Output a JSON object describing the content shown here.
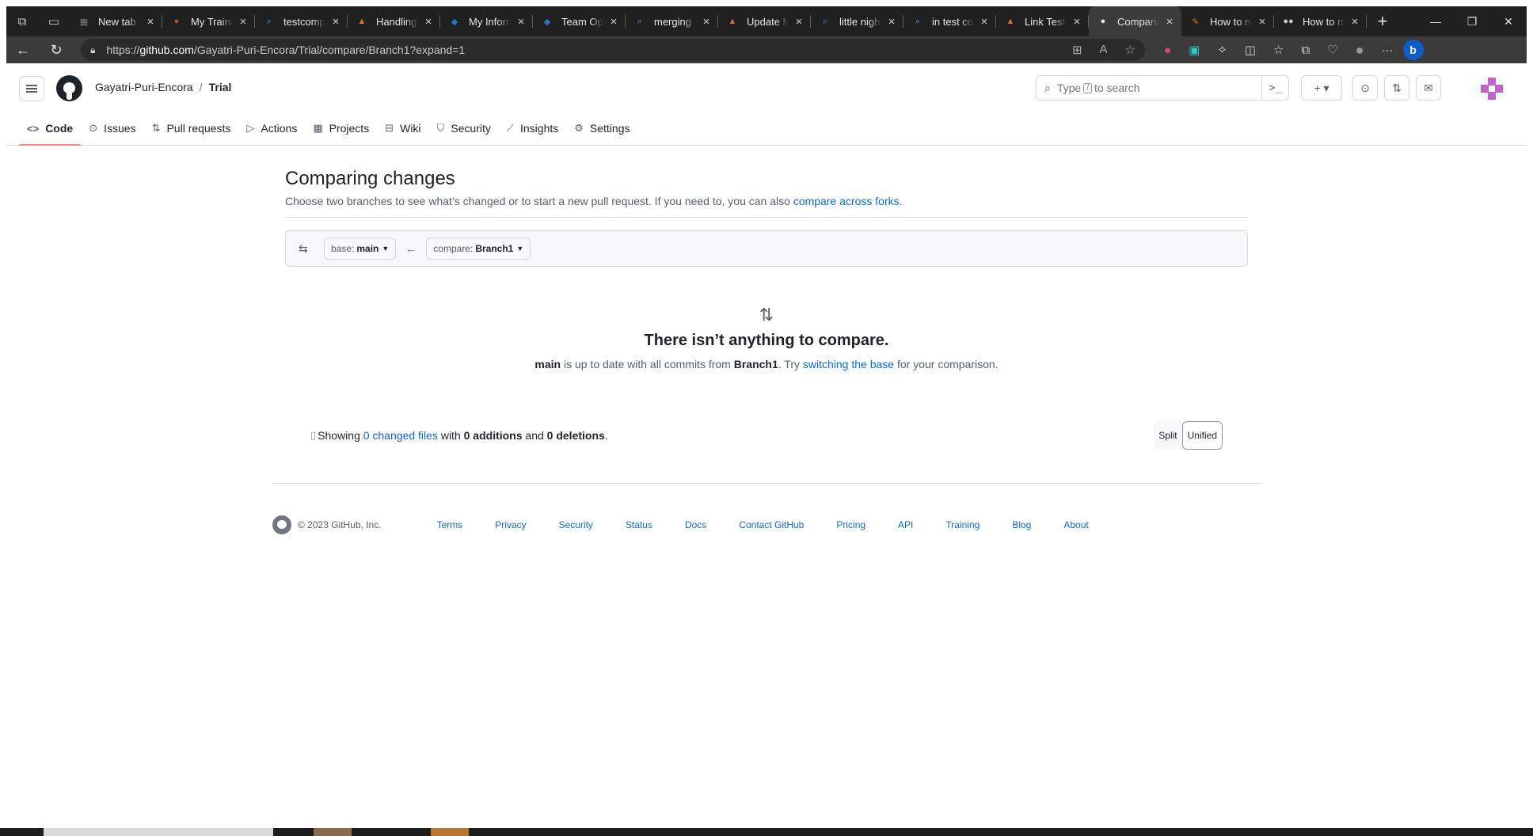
{
  "browser": {
    "tabs": [
      {
        "title": "New tab",
        "fav": "▦",
        "color": "#7a7a7a"
      },
      {
        "title": "My Training",
        "fav": "●",
        "color": "#b2532a"
      },
      {
        "title": "testcomp",
        "fav": "⌕",
        "color": "#4aa0e6"
      },
      {
        "title": "Handling",
        "fav": "▲",
        "color": "#d9712b"
      },
      {
        "title": "My Inform",
        "fav": "◆",
        "color": "#1f78d1"
      },
      {
        "title": "Team Opt",
        "fav": "◆",
        "color": "#1f78d1"
      },
      {
        "title": "merging",
        "fav": "⌕",
        "color": "#4aa0e6"
      },
      {
        "title": "Update N",
        "fav": "▲",
        "color": "#d9712b"
      },
      {
        "title": "little nigh",
        "fav": "⌕",
        "color": "#4aa0e6"
      },
      {
        "title": "in test co",
        "fav": "⌕",
        "color": "#4aa0e6"
      },
      {
        "title": "Link TestC",
        "fav": "▲",
        "color": "#d9712b"
      },
      {
        "title": "Comparin",
        "fav": "●",
        "color": "#e6e6e6",
        "active": true
      },
      {
        "title": "How to m",
        "fav": "✎",
        "color": "#d9712b"
      },
      {
        "title": "How to m",
        "fav": "●●",
        "color": "#cccccc"
      }
    ],
    "url_prefix": "https://",
    "url_host": "github.com",
    "url_path": "/Gayatri-Puri-Encora/Trial/compare/Branch1?expand=1"
  },
  "header": {
    "owner": "Gayatri-Puri-Encora",
    "separator": "/",
    "repo": "Trial",
    "search_before": "Type",
    "search_key": "/",
    "search_after": "to search",
    "plus_label": "+ ▾"
  },
  "repo_nav": [
    {
      "label": "Code",
      "icon": "<>",
      "selected": true
    },
    {
      "label": "Issues",
      "icon": "⊙"
    },
    {
      "label": "Pull requests",
      "icon": "⇅"
    },
    {
      "label": "Actions",
      "icon": "▷"
    },
    {
      "label": "Projects",
      "icon": "▦"
    },
    {
      "label": "Wiki",
      "icon": "⊟"
    },
    {
      "label": "Security",
      "icon": "⛉"
    },
    {
      "label": "Insights",
      "icon": "⟋"
    },
    {
      "label": "Settings",
      "icon": "⚙"
    }
  ],
  "compare": {
    "title": "Comparing changes",
    "description": "Choose two branches to see what’s changed or to start a new pull request. If you need to, you can also",
    "forks_link": "compare across forks",
    "forks_end": ".",
    "base_label": "base:",
    "base_value": "main",
    "compare_label": "compare:",
    "compare_value": "Branch1",
    "empty_title": "There isn’t anything to compare.",
    "empty_base": "main",
    "empty_mid": "is up to date with all commits from",
    "empty_branch": "Branch1",
    "empty_try": ". Try",
    "empty_link": "switching the base",
    "empty_end": "for your comparison.",
    "toc_showing": "Showing",
    "toc_files_link": "0 changed files",
    "toc_with": "with",
    "toc_additions": "0 additions",
    "toc_and": "and",
    "toc_deletions": "0 deletions",
    "toc_period": ".",
    "split_label": "Split",
    "unified_label": "Unified"
  },
  "footer": {
    "copyright": "© 2023 GitHub, Inc.",
    "links": [
      "Terms",
      "Privacy",
      "Security",
      "Status",
      "Docs",
      "Contact GitHub",
      "Pricing",
      "API",
      "Training",
      "Blog",
      "About"
    ]
  },
  "colors": {
    "link": "#0969da",
    "selected_tab_underline": "#fd8c73",
    "browser_dark": "#202020"
  }
}
